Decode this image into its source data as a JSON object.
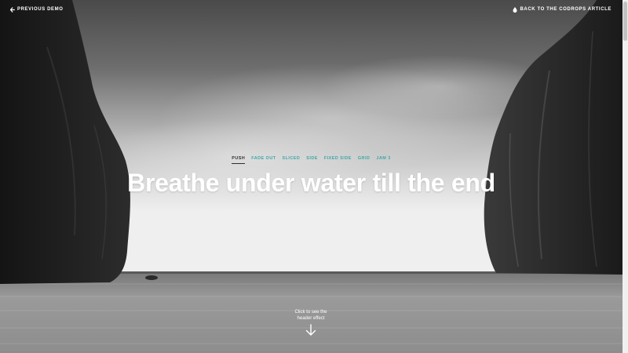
{
  "top_nav": {
    "previous_label": "PREVIOUS DEMO",
    "previous_icon": "arrow-left-icon",
    "back_label": "BACK TO THE CODROPS ARTICLE",
    "back_icon": "drop-icon"
  },
  "effects": {
    "items": [
      {
        "label": "PUSH",
        "active": true
      },
      {
        "label": "FADE OUT",
        "active": false
      },
      {
        "label": "SLICED",
        "active": false
      },
      {
        "label": "SIDE",
        "active": false
      },
      {
        "label": "FIXED SIDE",
        "active": false
      },
      {
        "label": "GRID",
        "active": false
      },
      {
        "label": "JAM 3",
        "active": false
      }
    ]
  },
  "hero": {
    "title": "Breathe under water till the end"
  },
  "trigger": {
    "line1": "Click to see the",
    "line2": "header effect",
    "icon": "arrow-down-icon"
  },
  "colors": {
    "accent": "#3fa7a3",
    "active": "#2f2f2f",
    "text_light": "#ffffff"
  },
  "scrollbar": {
    "scroll_position": 0
  }
}
